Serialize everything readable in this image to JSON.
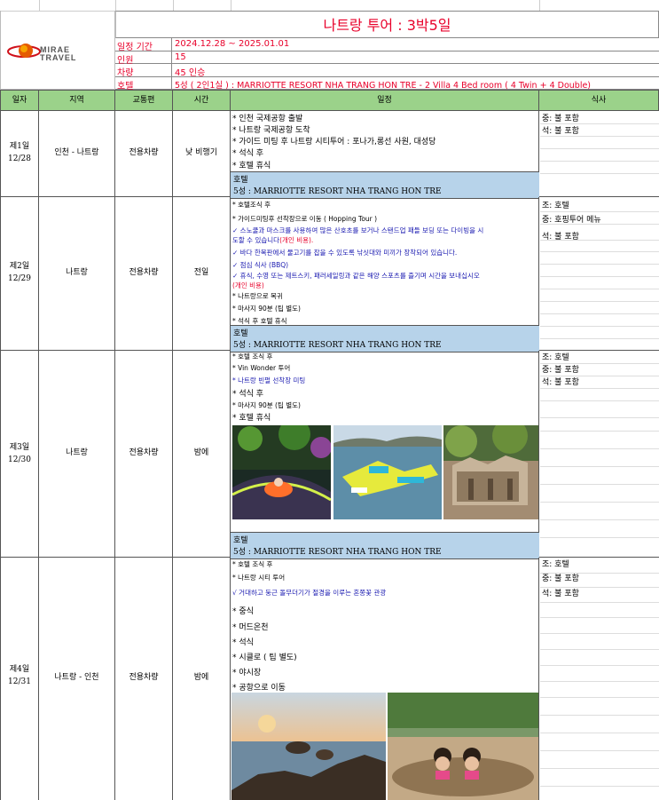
{
  "logo": {
    "line1": "MIRAE",
    "line2": "TRAVEL"
  },
  "title": "나트랑 투어 :  3박5일",
  "info": [
    {
      "label": "일정 기간",
      "value": "2024.12.28 ~ 2025.01.01"
    },
    {
      "label": "인원",
      "value": "15"
    },
    {
      "label": "차량",
      "value": "45 인승"
    },
    {
      "label": "호텔",
      "value": "5성 ( 2인1실 ) : MARRIOTTE  RESORT NHA TRANG HON TRE - 2 Villa 4 Bed room ( 4 Twin + 4 Double)"
    }
  ],
  "headers": {
    "day": "일자",
    "region": "지역",
    "transport": "교통편",
    "time": "시간",
    "schedule": "일정",
    "meal": "식사"
  },
  "hotel_block": {
    "label": "호텔",
    "name": "5성 :  MARRIOTTE  RESORT NHA TRANG HON TRE"
  },
  "days": [
    {
      "day": "제1일",
      "date": "12/28",
      "region": "인천 - 나트랑",
      "transport": "전용차량",
      "time": "낮 비행기",
      "schedule": [
        "* 인천 국제공항 출발",
        "* 나트랑 국제공항 도착",
        "* 가이드 미팅 후 나트랑 시티투어 : 포나가,롱선 사원, 대성당",
        "* 석식 후",
        "* 호텔 휴식"
      ],
      "meals": [
        "중: 불 포함",
        "석: 불 포함"
      ]
    },
    {
      "day": "제2일",
      "date": "12/29",
      "region": "나트랑",
      "transport": "전용차량",
      "time": "전일",
      "schedule": [
        "* 호텔조식 후",
        "* 가이드미팅후 선착장으로 이동 ( Hopping Tour )",
        "✓   스노쿨과 마스크를 사용하여 많은 산호초를 보거나 스탠드업 패들 보딩 또는 다이빙을 시",
        "도할 수 있습니다",
        "(개인 비용).",
        "✓   바다 한복판에서 물고기를 잡을 수 있도록 낚싯대와 미끼가 장착되어 있습니다.",
        "✓   점심 식사 (BBQ)",
        "✓   휴식, 수영 또는 제트스키, 패러세일링과 같은 해양 스포츠를 즐기며 시간을 보내십시오",
        "(개인 비용)",
        "* 나트랑으로 복귀",
        "* 마사지 90분 (팁 별도)",
        "* 석식 후  호텔 휴식"
      ],
      "meals": [
        "조: 호텔",
        "중: 호핑투어 메뉴",
        "석: 불 포함"
      ]
    },
    {
      "day": "제3일",
      "date": "12/30",
      "region": "나트랑",
      "transport": "전용차량",
      "time": "밤에",
      "schedule": [
        "* 호텔 조식 후",
        "* Vin Wonder 투어",
        "* 나트랑 빈펄 선착장 미팅",
        "* 석식 후",
        "* 마사지 90분 (팁 별도)",
        "* 호텔 휴식"
      ],
      "meals": [
        "조: 호텔",
        "중: 불 포함",
        "석: 불 포함"
      ]
    },
    {
      "day": "제4일",
      "date": "12/31",
      "region": "나트랑 - 인천",
      "transport": "전용차량",
      "time": "밤에",
      "schedule": [
        "* 호텔 조식 후",
        "* 나트랑 시티 투어",
        "√ 거대하고 둥근 돌무더기가  절경을 이루는 혼쫑꽃 관광",
        "* 중식",
        "* 머드온천",
        "* 석식",
        "* 시클로 ( 팁 별도)",
        "* 야시장",
        "* 공항으로 이동"
      ],
      "meals": [
        "조: 호텔",
        "중: 불 포함",
        "석: 불 포함"
      ]
    }
  ],
  "colors": {
    "accent_red": "#e8002a",
    "header_green": "#9bd28a",
    "hotel_blue": "#b7d3ea",
    "text_blue": "#1a1ab0"
  }
}
